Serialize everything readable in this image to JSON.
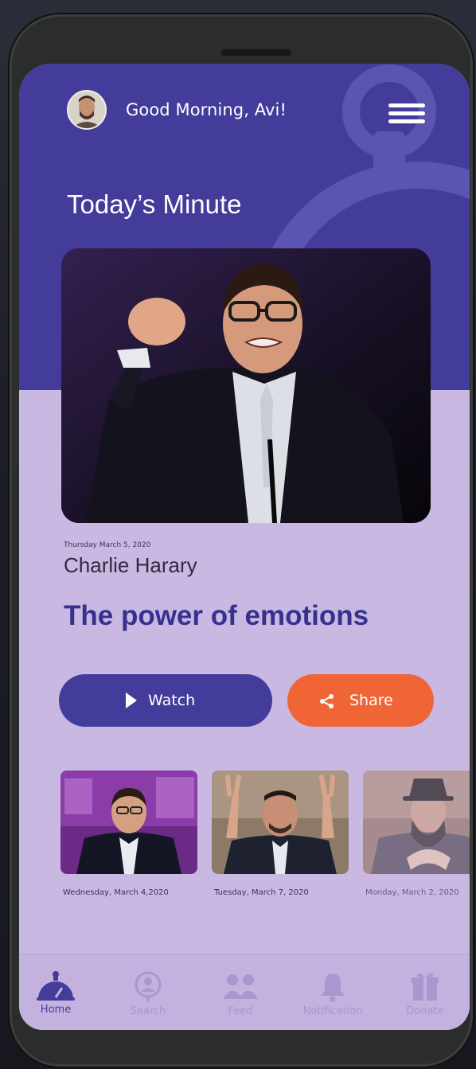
{
  "header": {
    "greeting": "Good Morning, Avi!"
  },
  "section_title": "Today’s Minute",
  "featured": {
    "date": "Thursday March 5, 2020",
    "speaker": "Charlie Harary",
    "title": "The power of emotions"
  },
  "actions": {
    "watch_label": "Watch",
    "share_label": "Share"
  },
  "recent": [
    {
      "date": "Wednesday, March 4,2020"
    },
    {
      "date": "Tuesday, March 7, 2020"
    },
    {
      "date": "Monday, March 2, 2020"
    }
  ],
  "tabs": [
    {
      "label": "Home",
      "icon": "stopwatch-icon",
      "active": true
    },
    {
      "label": "Search",
      "icon": "search-person-icon",
      "active": false
    },
    {
      "label": "Feed",
      "icon": "people-icon",
      "active": false
    },
    {
      "label": "Notification",
      "icon": "bell-icon",
      "active": false
    },
    {
      "label": "Donate",
      "icon": "gift-icon",
      "active": false
    }
  ],
  "colors": {
    "primary": "#433c9b",
    "accent": "#ef6536",
    "surface": "#c9b8e2"
  }
}
